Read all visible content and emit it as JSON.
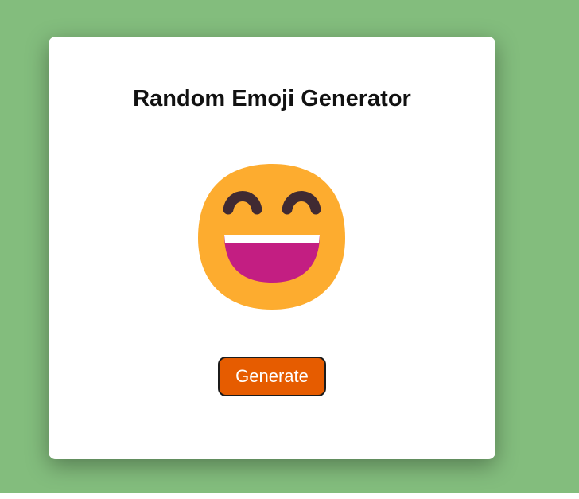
{
  "page": {
    "background_color": "#83bd7d"
  },
  "card": {
    "title": "Random Emoji Generator"
  },
  "emoji": {
    "icon": "grinning-face-with-smiling-eyes-icon",
    "face_color": "#fdac2f",
    "mouth_color": "#c31e82",
    "eye_color": "#402a32"
  },
  "actions": {
    "generate_label": "Generate",
    "button_color": "#e65c00"
  }
}
